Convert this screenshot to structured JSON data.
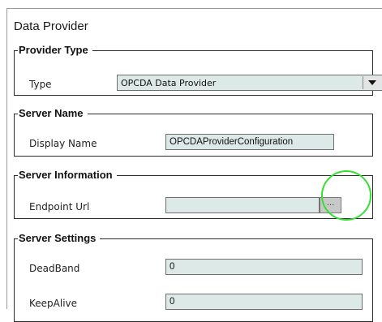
{
  "panel": {
    "title": "Data Provider"
  },
  "provider_type": {
    "legend": "Provider Type",
    "type_label": "Type",
    "type_value": "OPCDA Data Provider",
    "dropdown_icon": "triangle-down-icon"
  },
  "server_name": {
    "legend": "Server Name",
    "display_name_label": "Display Name",
    "display_name_value": "OPCDAProviderConfiguration"
  },
  "server_information": {
    "legend": "Server Information",
    "endpoint_label": "Endpoint Url",
    "endpoint_value": "",
    "browse_label": "..."
  },
  "server_settings": {
    "legend": "Server Settings",
    "deadband_label": "DeadBand",
    "deadband_value": "0",
    "keepalive_label": "KeepAlive",
    "keepalive_value": "0"
  },
  "colors": {
    "field_background": "#dce9e7",
    "highlight_ring": "#33e033"
  }
}
